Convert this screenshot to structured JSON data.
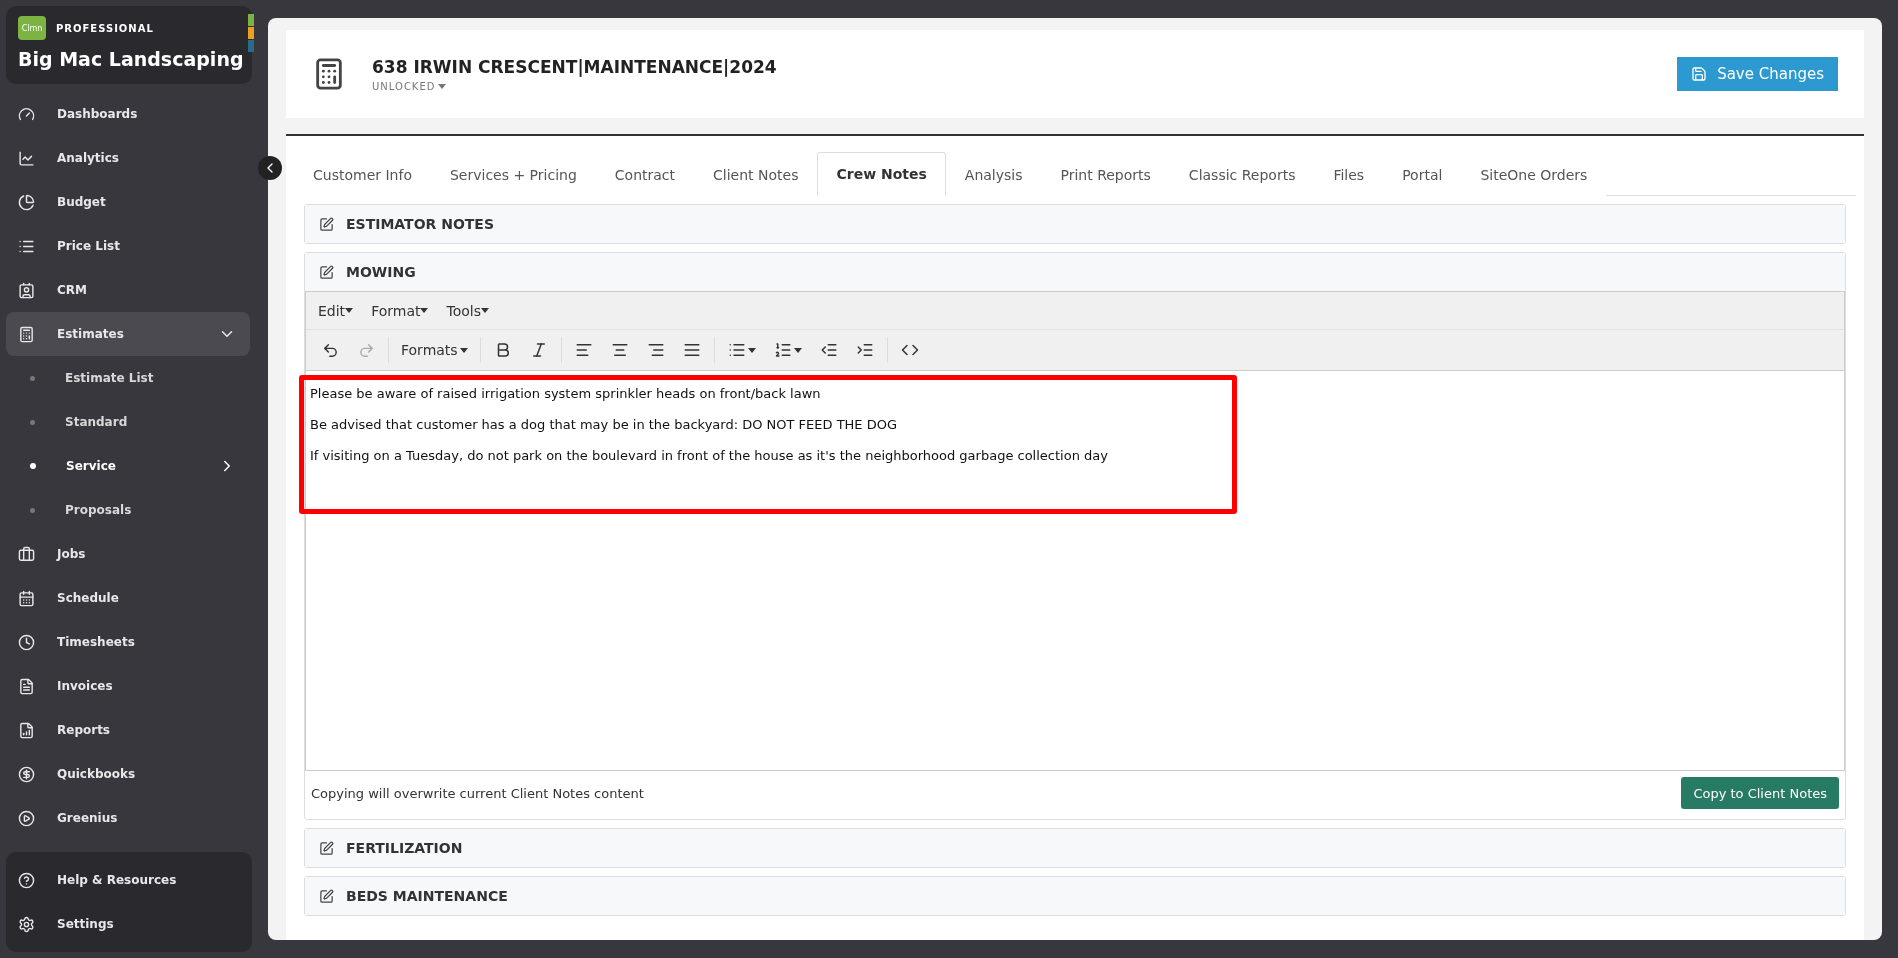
{
  "brand": {
    "logo": "Clmn",
    "edition": "PROFESSIONAL",
    "company": "Big Mac Landscaping"
  },
  "sidebar": {
    "items": [
      {
        "label": "Dashboards",
        "selected": false
      },
      {
        "label": "Analytics",
        "selected": false
      },
      {
        "label": "Budget",
        "selected": false
      },
      {
        "label": "Price List",
        "selected": false
      },
      {
        "label": "CRM",
        "selected": false
      },
      {
        "label": "Estimates",
        "selected": true,
        "expanded": true,
        "children": [
          {
            "label": "Estimate List",
            "selected": false,
            "has_submenu": false
          },
          {
            "label": "Standard",
            "selected": false,
            "has_submenu": false
          },
          {
            "label": "Service",
            "selected": true,
            "has_submenu": true
          },
          {
            "label": "Proposals",
            "selected": false,
            "has_submenu": false
          }
        ]
      },
      {
        "label": "Jobs",
        "selected": false
      },
      {
        "label": "Schedule",
        "selected": false
      },
      {
        "label": "Timesheets",
        "selected": false
      },
      {
        "label": "Invoices",
        "selected": false
      },
      {
        "label": "Reports",
        "selected": false
      },
      {
        "label": "Quickbooks",
        "selected": false
      },
      {
        "label": "Greenius",
        "selected": false
      }
    ],
    "bottom_items": [
      {
        "label": "Help & Resources"
      },
      {
        "label": "Settings"
      }
    ]
  },
  "header": {
    "title": "638 IRWIN CRESCENT|MAINTENANCE|2024",
    "status": "UNLOCKED",
    "save_button": "Save Changes"
  },
  "tabs": [
    {
      "label": "Customer Info",
      "selected": false
    },
    {
      "label": "Services + Pricing",
      "selected": false
    },
    {
      "label": "Contract",
      "selected": false
    },
    {
      "label": "Client Notes",
      "selected": false
    },
    {
      "label": "Crew Notes",
      "selected": true
    },
    {
      "label": "Analysis",
      "selected": false
    },
    {
      "label": "Print Reports",
      "selected": false
    },
    {
      "label": "Classic Reports",
      "selected": false
    },
    {
      "label": "Files",
      "selected": false
    },
    {
      "label": "Portal",
      "selected": false
    },
    {
      "label": "SiteOne Orders",
      "selected": false
    }
  ],
  "sections": [
    {
      "title": "ESTIMATOR NOTES"
    },
    {
      "title": "MOWING",
      "editor": {
        "menus": [
          "Edit",
          "Format",
          "Tools"
        ],
        "formats_label": "Formats",
        "lines": [
          "Please be aware of raised irrigation system sprinkler heads on front/back lawn",
          "Be advised that customer has a dog that may be in the backyard:  DO NOT FEED THE DOG",
          "If visiting on a Tuesday, do not park on the boulevard in front of the house as it's the neighborhood garbage collection day"
        ],
        "highlighted": true
      },
      "footer_note": "Copying will overwrite current Client Notes content",
      "copy_button": "Copy to Client Notes"
    },
    {
      "title": "FERTILIZATION"
    },
    {
      "title": "BEDS MAINTENANCE"
    }
  ]
}
